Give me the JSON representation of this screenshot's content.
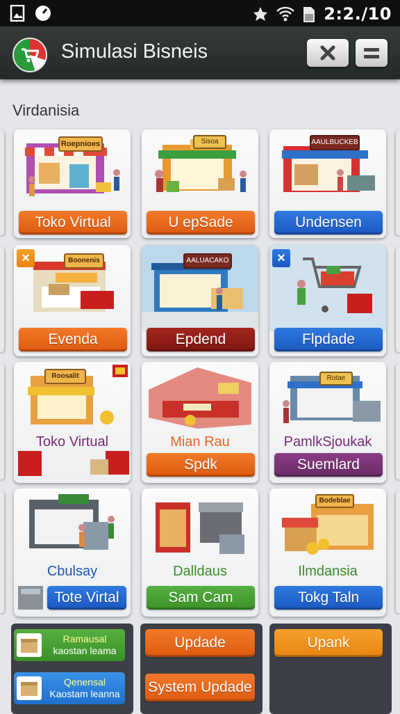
{
  "status_bar": {
    "time": "2:2./10",
    "icons": [
      "photo-icon",
      "speed-icon",
      "signal-icon",
      "wifi-icon",
      "sim-icon"
    ]
  },
  "app_bar": {
    "title": "Simulasi Bisneis",
    "close_icon": "close-icon",
    "menu_icon": "menu-icon"
  },
  "section": {
    "title": "Virdanisia"
  },
  "cards": [
    {
      "sign": "Roepnioes",
      "button": "Toko Virtual",
      "color": "#e8631c"
    },
    {
      "sign": "Sisoa",
      "button": "U epSade",
      "color": "#e8631c"
    },
    {
      "sign": "AAULBUCKEB",
      "button": "Undensen",
      "color": "#2563cc"
    },
    {
      "sign": "Boonenis",
      "button": "Evenda",
      "color": "#e8631c",
      "badge": "×"
    },
    {
      "sign": "AALUACAKO",
      "button": "Epdend",
      "color": "#8c1c16"
    },
    {
      "button": "Flpdade",
      "color": "#2563cc",
      "badge": "×"
    },
    {
      "sign": "Roosalit",
      "label": "Toko Virtual",
      "label_color": "#7a2a78"
    },
    {
      "label": "Mian Rau",
      "label_color": "#e8631c",
      "button": "Spdk",
      "color": "#e8631c"
    },
    {
      "sign": "Rotae",
      "label": "PamlkSjoukak",
      "label_color": "#7a2a78",
      "button": "Suemlard",
      "color": "#7a2f76"
    },
    {
      "label": "Cbulsay",
      "label_color": "#1f55b8",
      "button": "Tote Virtal",
      "color": "#2563cc"
    },
    {
      "label": "Dalldaus",
      "label_color": "#3c8a28",
      "button": "Sam Cam",
      "color": "#4aa333"
    },
    {
      "sign": "Bodeblae",
      "label": "Ilmdansia",
      "label_color": "#3c8a28",
      "button": "Tokg Taln",
      "color": "#2f7ae0"
    }
  ],
  "bottom": {
    "promos": [
      {
        "line1": "Ramausal",
        "line2": "kaostan leama",
        "color": "#4aa333"
      },
      {
        "line1": "Qenensal",
        "line2": "Kaostam leanna",
        "color": "#2f86e0"
      }
    ],
    "update_buttons": [
      "Updade",
      "System Updade"
    ],
    "upank": "Upank"
  }
}
